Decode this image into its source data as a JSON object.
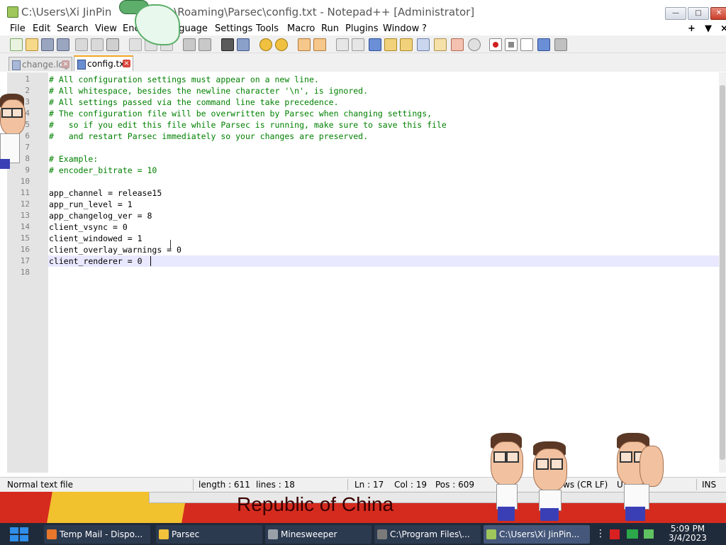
{
  "window": {
    "title": "C:\\Users\\Xi JinPing\\AppData\\Roaming\\Parsec\\config.txt - Notepad++ [Administrator]",
    "title_left": "C:\\Users\\Xi JinPin",
    "title_right": "a\\Roaming\\Parsec\\config.txt - Notepad++ [Administrator]",
    "minimize_icon": "minimize-icon",
    "maximize_icon": "maximize-icon",
    "close_icon": "close-icon"
  },
  "menu": {
    "items": [
      "File",
      "Edit",
      "Search",
      "View",
      "Encoding",
      "Language",
      "Settings",
      "Tools",
      "Macro",
      "Run",
      "Plugins",
      "Window",
      "?"
    ],
    "visible": {
      "file": "File",
      "edit": "Edit",
      "search": "Search",
      "view": "View",
      "encoding": "Enc",
      "language": "anguage",
      "settings": "Settings",
      "tools": "Tools",
      "macro": "Macro",
      "run": "Run",
      "plugins": "Plugins",
      "window": "Window",
      "help": "?"
    },
    "right": {
      "plus": "+",
      "down": "▼",
      "close": "×"
    }
  },
  "tabs": [
    {
      "label": "change.log",
      "active": false
    },
    {
      "label": "config.txt",
      "active": true
    }
  ],
  "editor": {
    "lines": [
      "# All configuration settings must appear on a new line.",
      "# All whitespace, besides the newline character '\\n', is ignored.",
      "# All settings passed via the command line take precedence.",
      "# The configuration file will be overwritten by Parsec when changing settings,",
      "#   so if you edit this file while Parsec is running, make sure to save this file",
      "#   and restart Parsec immediately so your changes are preserved.",
      "",
      "# Example:",
      "# encoder_bitrate = 10",
      "",
      "app_channel = release15",
      "app_run_level = 1",
      "app_changelog_ver = 8",
      "client_vsync = 0",
      "client_windowed = 1",
      "client_overlay_warnings = 0",
      "client_renderer = 0",
      ""
    ],
    "line_numbers": [
      "1",
      "2",
      "3",
      "4",
      "5",
      "6",
      "7",
      "8",
      "9",
      "10",
      "11",
      "12",
      "13",
      "14",
      "15",
      "16",
      "17",
      "18"
    ],
    "current_line": 17
  },
  "status": {
    "file_type": "Normal text file",
    "length": "length : 611",
    "lines": "lines : 18",
    "ln": "Ln : 17",
    "col": "Col : 19",
    "pos": "Pos : 609",
    "eol": "ws (CR LF)",
    "encoding": "U",
    "mode": "INS"
  },
  "desktop": {
    "wallpaper_text": "Republic of China"
  },
  "taskbar": {
    "items": [
      {
        "label": "Temp Mail - Dispo...",
        "icon": "firefox-icon",
        "color": "#e8762b",
        "active": false
      },
      {
        "label": "Parsec",
        "icon": "folder-icon",
        "color": "#f2c23c",
        "active": false
      },
      {
        "label": "Minesweeper",
        "icon": "minesweeper-icon",
        "color": "#9aa0a8",
        "active": false
      },
      {
        "label": "C:\\Program Files\\...",
        "icon": "winrar-icon",
        "color": "#7a7a7a",
        "active": false
      },
      {
        "label": "C:\\Users\\Xi JinPin...",
        "icon": "notepadpp-icon",
        "color": "#9ec65a",
        "active": true
      }
    ],
    "clock_time": "5:09 PM",
    "clock_date": "3/4/2023"
  },
  "colors": {
    "comment": "#008000",
    "current_line": "#e8e8ff",
    "gutter": "#e4e4e4",
    "tab_accent": "#f5a623",
    "taskbar": "#1f2a3a",
    "wallpaper": "#d52b1e"
  }
}
